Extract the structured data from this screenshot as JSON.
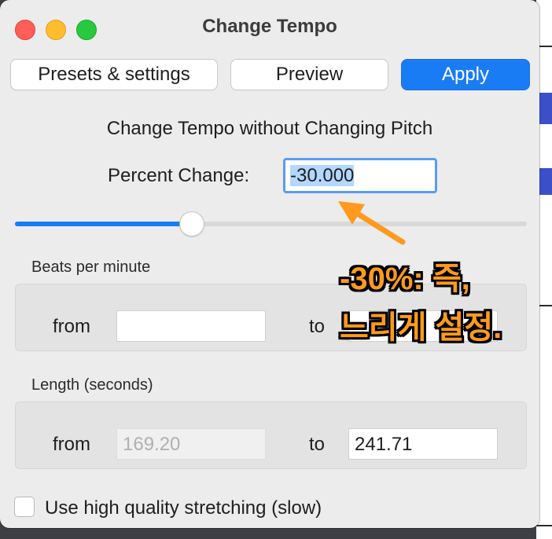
{
  "window": {
    "title": "Change Tempo"
  },
  "toolbar": {
    "presets_label": "Presets & settings",
    "preview_label": "Preview",
    "apply_label": "Apply"
  },
  "main": {
    "heading": "Change Tempo without Changing Pitch",
    "percent_change_label": "Percent Change:",
    "percent_change_value": "-30.000",
    "slider_fraction": 0.345
  },
  "bpm": {
    "title": "Beats per minute",
    "from_label": "from",
    "from_value": "",
    "to_label": "to",
    "to_value": ""
  },
  "length": {
    "title": "Length (seconds)",
    "from_label": "from",
    "from_value": "169.20",
    "to_label": "to",
    "to_value": "241.71"
  },
  "options": {
    "high_quality_label": "Use high quality stretching (slow)",
    "high_quality_checked": false
  },
  "annotation": {
    "line1": "-30%: 즉,",
    "line2": "느리게 설정."
  },
  "colors": {
    "accent": "#1a7cf5",
    "annotation": "#ff9a1e"
  }
}
